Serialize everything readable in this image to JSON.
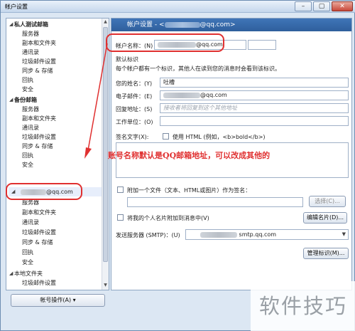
{
  "window": {
    "title": "帐户设置"
  },
  "tree": {
    "groups": [
      {
        "label": "私人测试邮箱",
        "children": [
          "服务器",
          "副本和文件夹",
          "通讯录",
          "垃圾邮件设置",
          "同步 & 存储",
          "回执",
          "安全"
        ]
      },
      {
        "label": "备份邮箱",
        "children": [
          "服务器",
          "副本和文件夹",
          "通讯录",
          "垃圾邮件设置",
          "同步 & 存储",
          "回执",
          "安全"
        ]
      },
      {
        "label": "@qq.com",
        "children": [
          "服务器",
          "副本和文件夹",
          "通讯录",
          "垃圾邮件设置",
          "同步 & 存储",
          "回执",
          "安全"
        ]
      },
      {
        "label": "本地文件夹",
        "children": [
          "垃圾邮件设置"
        ]
      }
    ],
    "account_actions": "帐号操作(A)"
  },
  "panel": {
    "header": "帐户设置 - <",
    "header_suffix": "@qq.com>",
    "account_name_label": "帐户名称：(N)",
    "account_name_value": "@qq.com",
    "default_identity": "默认标识",
    "identity_desc": "每个帐户都有一个标识，其他人在读到您的消息时会看到该标识。",
    "name_label": "您的姓名：(Y)",
    "name_value": "吐槽",
    "email_label": "电子邮件：(E)",
    "email_value": "@qq.com",
    "reply_label": "回复地址：(S)",
    "reply_placeholder": "接收者将回复到这个其他地址",
    "org_label": "工作单位：(O)",
    "signature_label": "签名文字(X):",
    "use_html_label": "使用 HTML (例如，<b>bold</b>)",
    "attach_label": "附加一个文件（文本、HTML或图片）作为签名：",
    "choose_button": "选择(C)...",
    "vcard_label": "将我的个人名片附加到消息中(V)",
    "edit_vcard_button": "编辑名片(D)...",
    "smtp_label": "发送服务器 (SMTP)：(U)",
    "smtp_value": "smtp.qq.com",
    "manage_identity_button": "管理标识(M)..."
  },
  "annotation": "账号名称默认是QQ邮箱地址，可以改成其他的",
  "watermark": "软件技巧",
  "colors": {
    "annotation_red": "#e03030",
    "header_blue": "#3a6cae"
  }
}
